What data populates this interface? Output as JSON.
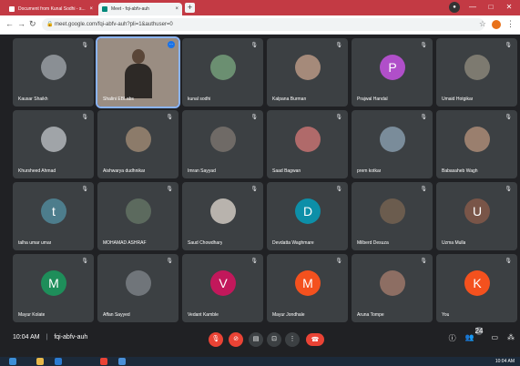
{
  "browser": {
    "tabs": [
      {
        "label": "Document from Kunal Sodhi - s...",
        "close": "×"
      },
      {
        "label": "Meet - fqi-abfv-auh",
        "close": "×"
      }
    ],
    "new_tab": "+",
    "url": "meet.google.com/fqi-abfv-auh?pli=1&authuser=0"
  },
  "participants": [
    {
      "name": "Kausar Shaikh",
      "type": "photo",
      "color": "#8a8f94"
    },
    {
      "name": "Shalini EBLabs",
      "type": "video",
      "color": "#9a8d82"
    },
    {
      "name": "kunal sodhi",
      "type": "photo",
      "color": "#6b8f71"
    },
    {
      "name": "Kalpana Burman",
      "type": "photo",
      "color": "#a58a7a"
    },
    {
      "name": "Prajwal Handal",
      "type": "initial",
      "initial": "P",
      "color": "#b04fc9"
    },
    {
      "name": "Umaid Hotgikar",
      "type": "photo",
      "color": "#7d7a70"
    },
    {
      "name": "Khursheed Ahmad",
      "type": "photo",
      "color": "#a0a4a8"
    },
    {
      "name": "Aishwarya dudhnikar",
      "type": "photo",
      "color": "#8c7b6a"
    },
    {
      "name": "Imran Sayyad",
      "type": "photo",
      "color": "#6f6a66"
    },
    {
      "name": "Saad Bagwan",
      "type": "photo",
      "color": "#b06a6a"
    },
    {
      "name": "prem kotkar",
      "type": "photo",
      "color": "#7a8c9a"
    },
    {
      "name": "Babasaheb Wagh",
      "type": "photo",
      "color": "#9a7f6e"
    },
    {
      "name": "talha umar umar",
      "type": "initial",
      "initial": "t",
      "color": "#4d7d8c"
    },
    {
      "name": "MOHAMAD ASHRAF",
      "type": "photo",
      "color": "#5c6a5e"
    },
    {
      "name": "Saud Chowdhary",
      "type": "photo",
      "color": "#b8b3ad"
    },
    {
      "name": "Devdatta Waghmare",
      "type": "initial",
      "initial": "D",
      "color": "#0d8fa8"
    },
    {
      "name": "Milberd Desuza",
      "type": "photo",
      "color": "#6b5c4e"
    },
    {
      "name": "Uzma Mulla",
      "type": "initial",
      "initial": "U",
      "color": "#795548"
    },
    {
      "name": "Mayur Kolate",
      "type": "initial",
      "initial": "M",
      "color": "#1e8e5a"
    },
    {
      "name": "Affan Sayyed",
      "type": "photo",
      "color": "#70757a"
    },
    {
      "name": "Vedant Kamble",
      "type": "initial",
      "initial": "V",
      "color": "#c2185b"
    },
    {
      "name": "Mayur Jondhale",
      "type": "initial",
      "initial": "M",
      "color": "#f4511e"
    },
    {
      "name": "Aruna Tompe",
      "type": "photo",
      "color": "#8d6e63"
    },
    {
      "name": "You",
      "type": "initial",
      "initial": "K",
      "color": "#f4511e"
    }
  ],
  "meeting": {
    "time": "10:04 AM",
    "separator": "|",
    "code": "fqi-abfv-auh"
  },
  "controls": {
    "participants_count": "24",
    "end_call_icon": "phone-end-icon"
  },
  "taskbar": {
    "clock": "10:04 AM"
  }
}
